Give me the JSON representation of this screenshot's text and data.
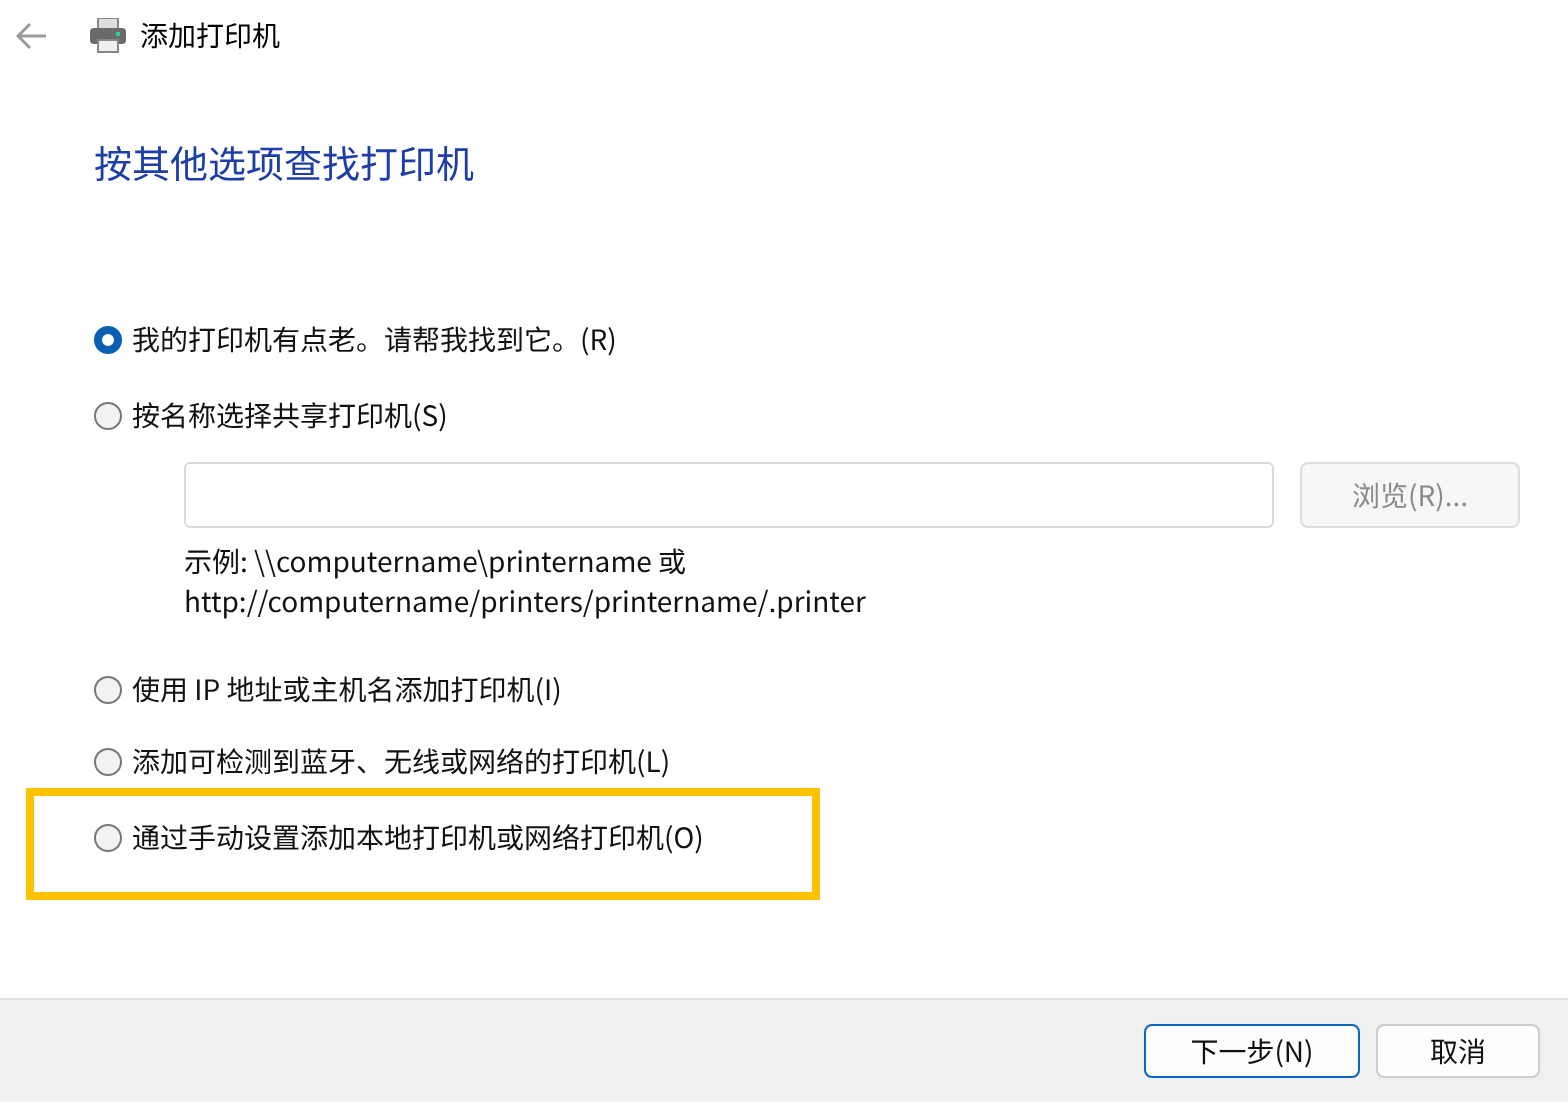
{
  "window": {
    "title": "添加打印机"
  },
  "heading": "按其他选项查找打印机",
  "options": [
    {
      "label": "我的打印机有点老。请帮我找到它。(R)",
      "selected": true,
      "highlighted": false
    },
    {
      "label": "按名称选择共享打印机(S)",
      "selected": false,
      "highlighted": false
    },
    {
      "label": "使用 IP 地址或主机名添加打印机(I)",
      "selected": false,
      "highlighted": false
    },
    {
      "label": "添加可检测到蓝牙、无线或网络的打印机(L)",
      "selected": false,
      "highlighted": false
    },
    {
      "label": "通过手动设置添加本地打印机或网络打印机(O)",
      "selected": false,
      "highlighted": true
    }
  ],
  "share": {
    "browse": {
      "label": "浏览(R)...",
      "disabled": true
    },
    "example_lines": [
      "示例: \\\\computername\\printername 或",
      "http://computername/printers/printername/.printer"
    ]
  },
  "buttons": [
    {
      "label": "下一步(N)",
      "default": true
    },
    {
      "label": "取消",
      "default": false
    }
  ]
}
